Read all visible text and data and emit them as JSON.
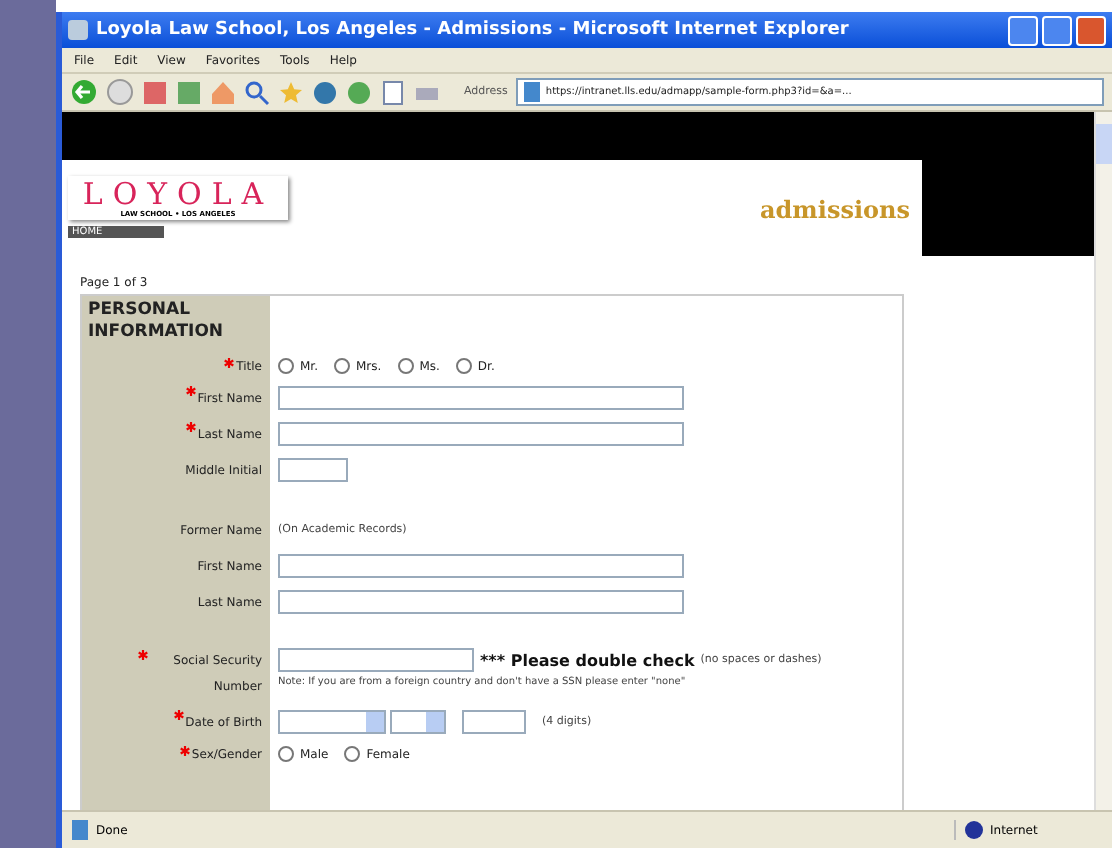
{
  "window": {
    "title": "Loyola Law School, Los Angeles - Admissions - Microsoft Internet Explorer"
  },
  "menu": [
    "File",
    "Edit",
    "View",
    "Favorites",
    "Tools",
    "Help"
  ],
  "address": {
    "label": "Address",
    "value": "https://intranet.lls.edu/admapp/sample-form.php3?id=&a=..."
  },
  "header": {
    "logo": "LOYOLA",
    "logo_sub": "LAW SCHOOL • LOS ANGELES",
    "home": "HOME",
    "section": "admissions"
  },
  "page_indicator": "Page 1 of 3",
  "section_title": "PERSONAL INFORMATION",
  "rows": [
    {
      "kind": "radios",
      "label": "Title",
      "required": true,
      "options": [
        {
          "label": "Mr.",
          "selected": false
        },
        {
          "label": "Mrs.",
          "selected": false
        },
        {
          "label": "Ms.",
          "selected": false
        },
        {
          "label": "Dr.",
          "selected": false
        }
      ]
    },
    {
      "kind": "text",
      "label": "First Name",
      "required": true
    },
    {
      "kind": "text",
      "label": "Last Name",
      "required": true
    },
    {
      "kind": "initial",
      "label": "Middle Initial",
      "required": false
    },
    {
      "kind": "note",
      "label": "Former Name",
      "required": false,
      "note": "(On Academic Records)"
    },
    {
      "kind": "text",
      "label": "First Name",
      "required": false
    },
    {
      "kind": "text",
      "label": "Last Name",
      "required": false
    },
    {
      "kind": "ssn",
      "label": "Social Security Number",
      "required": true,
      "warning": "*** Please double check",
      "hint": "(no spaces or dashes)",
      "note": "Note: If you are from a foreign country and don't have a SSN please enter \"none\""
    },
    {
      "kind": "date",
      "label": "Date of Birth",
      "required": true,
      "hint": "(4 digits)"
    },
    {
      "kind": "radios",
      "label": "Sex/Gender",
      "required": true,
      "options": [
        {
          "label": "Male",
          "selected": false
        },
        {
          "label": "Female",
          "selected": false
        }
      ]
    }
  ],
  "status_bar": {
    "text": "Done",
    "zone": "Internet"
  }
}
